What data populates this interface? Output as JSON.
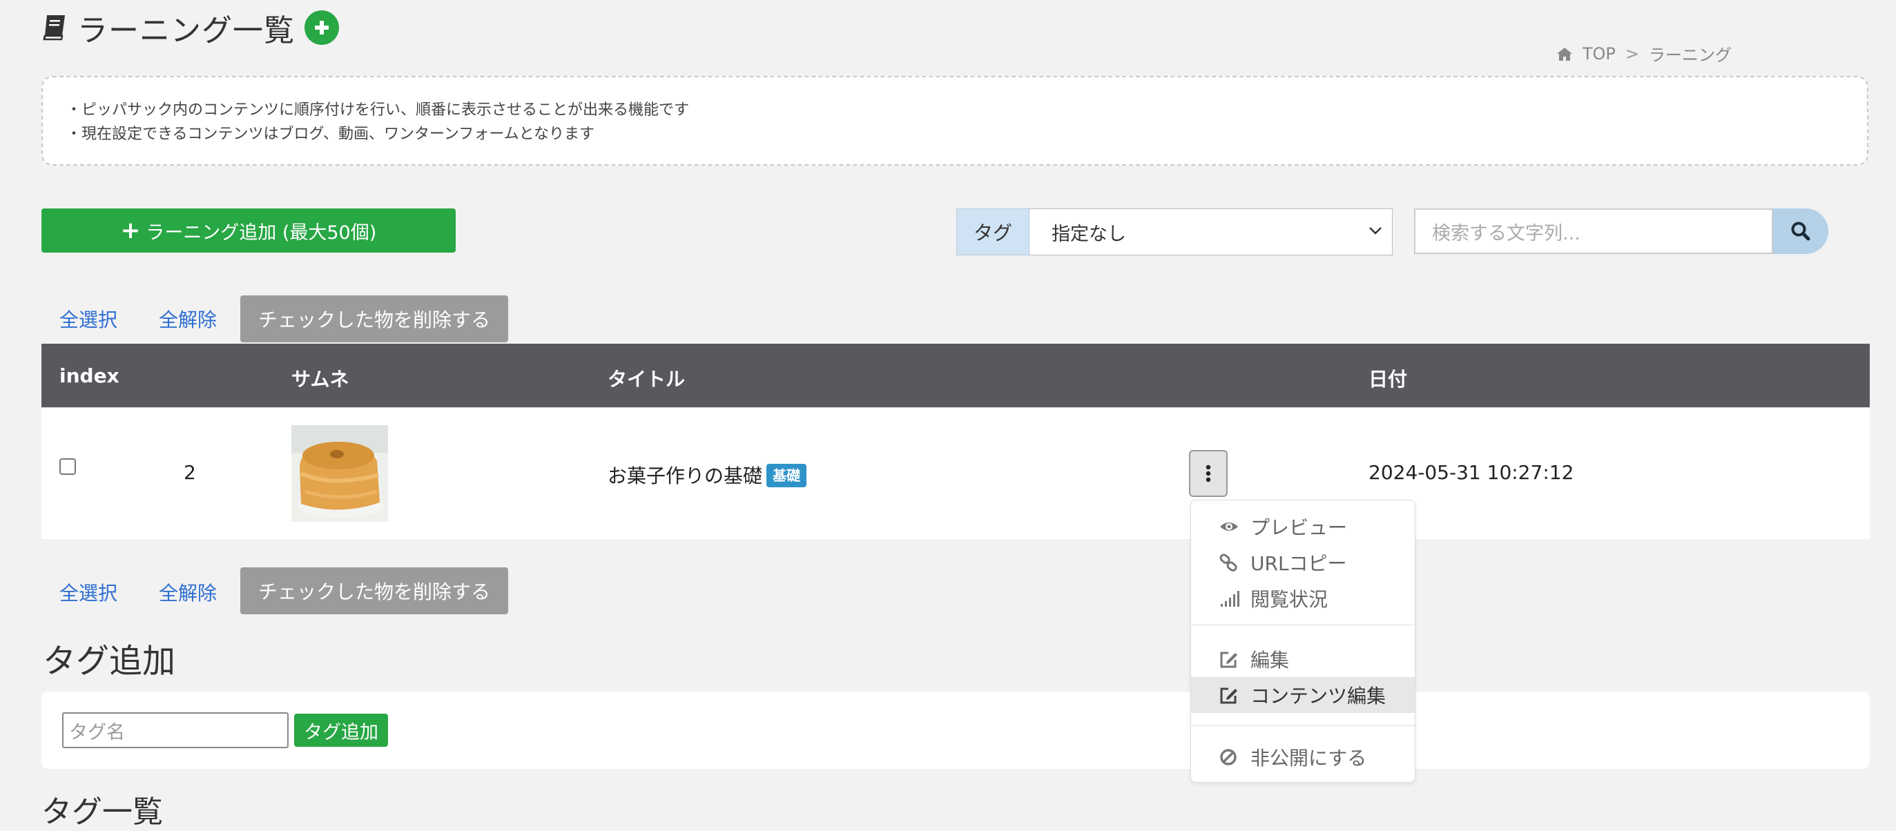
{
  "header": {
    "title": "ラーニング一覧",
    "icon": "book-icon",
    "add_icon": "plus-circle-icon"
  },
  "breadcrumb": {
    "home_icon": "home-icon",
    "top": "TOP",
    "separator": ">",
    "current": "ラーニング"
  },
  "description": {
    "line1": "・ピッパサック内のコンテンツに順序付けを行い、順番に表示させることが出来る機能です",
    "line2": "・現在設定できるコンテンツはブログ、動画、ワンターンフォームとなります"
  },
  "toolbar": {
    "add_label": "ラーニング追加 (最大50個)",
    "tag_label": "タグ",
    "tag_selected": "指定なし",
    "search_placeholder": "検索する文字列..."
  },
  "bulk_actions": {
    "select_all": "全選択",
    "deselect_all": "全解除",
    "delete_checked": "チェックした物を削除する"
  },
  "table": {
    "headers": [
      "index",
      "サムネ",
      "タイトル",
      "日付"
    ],
    "rows": [
      {
        "checked": false,
        "index": "2",
        "thumbnail": "chiffon-cake-image",
        "title": "お菓子作りの基礎",
        "badge": "基礎",
        "date": "2024-05-31 10:27:12"
      }
    ]
  },
  "context_menu": {
    "items": [
      {
        "label": "プレビュー",
        "icon": "eye-icon"
      },
      {
        "label": "URLコピー",
        "icon": "link-icon"
      },
      {
        "label": "閲覧状況",
        "icon": "signal-icon"
      },
      {
        "label": "編集",
        "icon": "edit-icon"
      },
      {
        "label": "コンテンツ編集",
        "icon": "edit-icon",
        "highlighted": true
      },
      {
        "label": "非公開にする",
        "icon": "ban-icon"
      }
    ]
  },
  "tag_section": {
    "title": "タグ追加",
    "input_placeholder": "タグ名",
    "add_button": "タグ追加",
    "next_title": "タグ一覧"
  },
  "colors": {
    "green": "#28a745",
    "table_header": "#58585f",
    "link": "#2e6fd0",
    "badge": "#2e93c8",
    "gray_button": "#9b9b9b",
    "tag_label_bg": "#cfe3f4"
  }
}
